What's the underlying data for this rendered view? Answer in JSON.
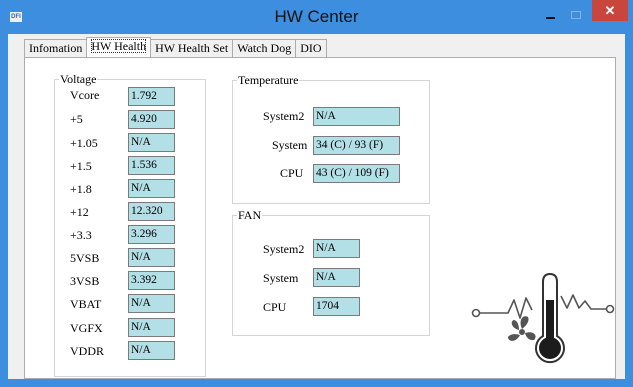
{
  "window": {
    "title": "HW Center",
    "icon_text": "DFI",
    "minimize_icon": "minimize-icon",
    "maximize_icon": "maximize-icon",
    "close_icon": "close-icon",
    "close_glyph": "✕"
  },
  "tabs": [
    {
      "label": "Infomation",
      "active": false
    },
    {
      "label": "HW Health",
      "active": true
    },
    {
      "label": "HW Health Set",
      "active": false
    },
    {
      "label": "Watch Dog",
      "active": false
    },
    {
      "label": "DIO",
      "active": false
    }
  ],
  "voltage": {
    "legend": "Voltage",
    "rows": [
      {
        "label": "Vcore",
        "value": "1.792"
      },
      {
        "label": "+5",
        "value": "4.920"
      },
      {
        "label": "+1.05",
        "value": "N/A"
      },
      {
        "label": "+1.5",
        "value": "1.536"
      },
      {
        "label": "+1.8",
        "value": "N/A"
      },
      {
        "label": "+12",
        "value": "12.320"
      },
      {
        "label": "+3.3",
        "value": "3.296"
      },
      {
        "label": "5VSB",
        "value": "N/A"
      },
      {
        "label": "3VSB",
        "value": "3.392"
      },
      {
        "label": "VBAT",
        "value": "N/A"
      },
      {
        "label": "VGFX",
        "value": "N/A"
      },
      {
        "label": "VDDR",
        "value": "N/A"
      }
    ]
  },
  "temperature": {
    "legend": "Temperature",
    "rows": [
      {
        "label": "System2",
        "value": "N/A"
      },
      {
        "label": "System",
        "value": "34 (C) / 93 (F)"
      },
      {
        "label": "CPU",
        "value": "43 (C) / 109 (F)"
      }
    ]
  },
  "fan": {
    "legend": "FAN",
    "rows": [
      {
        "label": "System2",
        "value": "N/A"
      },
      {
        "label": "System",
        "value": "N/A"
      },
      {
        "label": "CPU",
        "value": "1704"
      }
    ]
  },
  "decoration": {
    "icon": "thermometer-fan-icon",
    "colors": {
      "accent": "#3d8ede",
      "field_bg": "#b3dfe6",
      "close_red": "#c9463d"
    }
  }
}
